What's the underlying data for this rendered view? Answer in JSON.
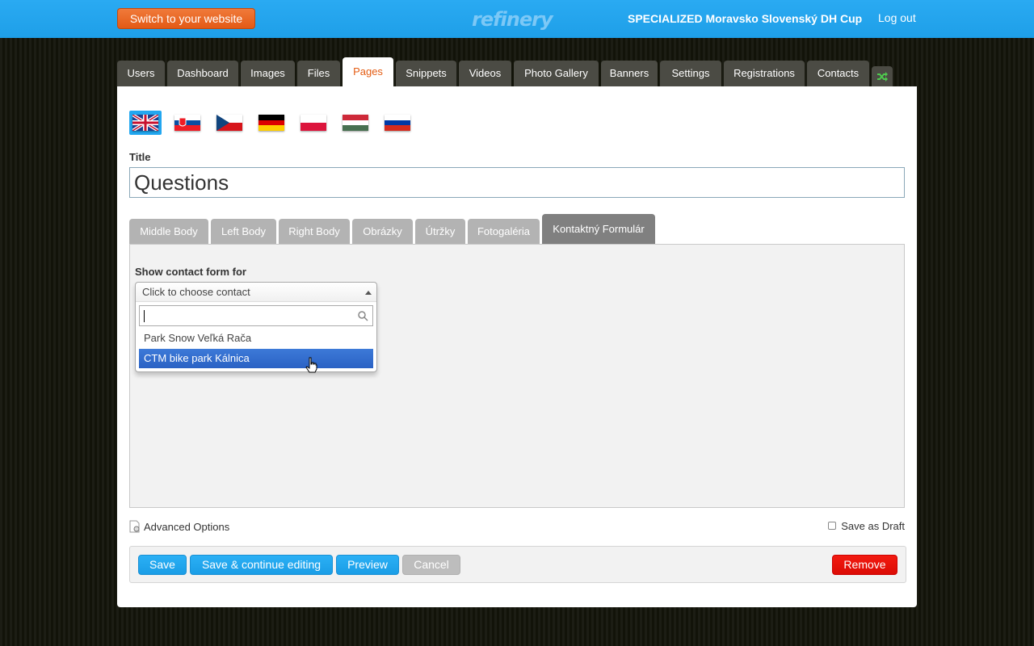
{
  "header": {
    "switch_label": "Switch to your website",
    "logo_text": "refinery",
    "site_name": "SPECIALIZED Moravsko Slovenský DH Cup",
    "logout_label": "Log out"
  },
  "main_tabs": [
    "Users",
    "Dashboard",
    "Images",
    "Files",
    "Pages",
    "Snippets",
    "Videos",
    "Photo Gallery",
    "Banners",
    "Settings",
    "Registrations",
    "Contacts"
  ],
  "active_main_tab": "Pages",
  "flags": [
    "english-flag",
    "slovak-flag",
    "czech-flag",
    "german-flag",
    "polish-flag",
    "hungarian-flag",
    "russian-flag"
  ],
  "form": {
    "title_label": "Title",
    "title_value": "Questions"
  },
  "sub_tabs": [
    "Middle Body",
    "Left Body",
    "Right Body",
    "Obrázky",
    "Útržky",
    "Fotogaléria",
    "Kontaktný Formulár"
  ],
  "active_sub_tab": "Kontaktný Formulár",
  "contact": {
    "label": "Show contact form for",
    "select_placeholder": "Click to choose contact",
    "search_value": "",
    "options": [
      "Park Snow Veľká Rača",
      "CTM bike park Kálnica"
    ],
    "highlighted_option": "CTM bike park Kálnica"
  },
  "footer": {
    "advanced_label": "Advanced Options",
    "draft_label": "Save as Draft",
    "save_label": "Save",
    "save_continue_label": "Save & continue editing",
    "preview_label": "Preview",
    "cancel_label": "Cancel",
    "remove_label": "Remove"
  },
  "colors": {
    "header_bg": "#22a7f0",
    "accent_orange": "#e45d14",
    "button_blue": "#22a7f0",
    "remove_red": "#e8120a",
    "highlight_blue": "#3071d0"
  }
}
